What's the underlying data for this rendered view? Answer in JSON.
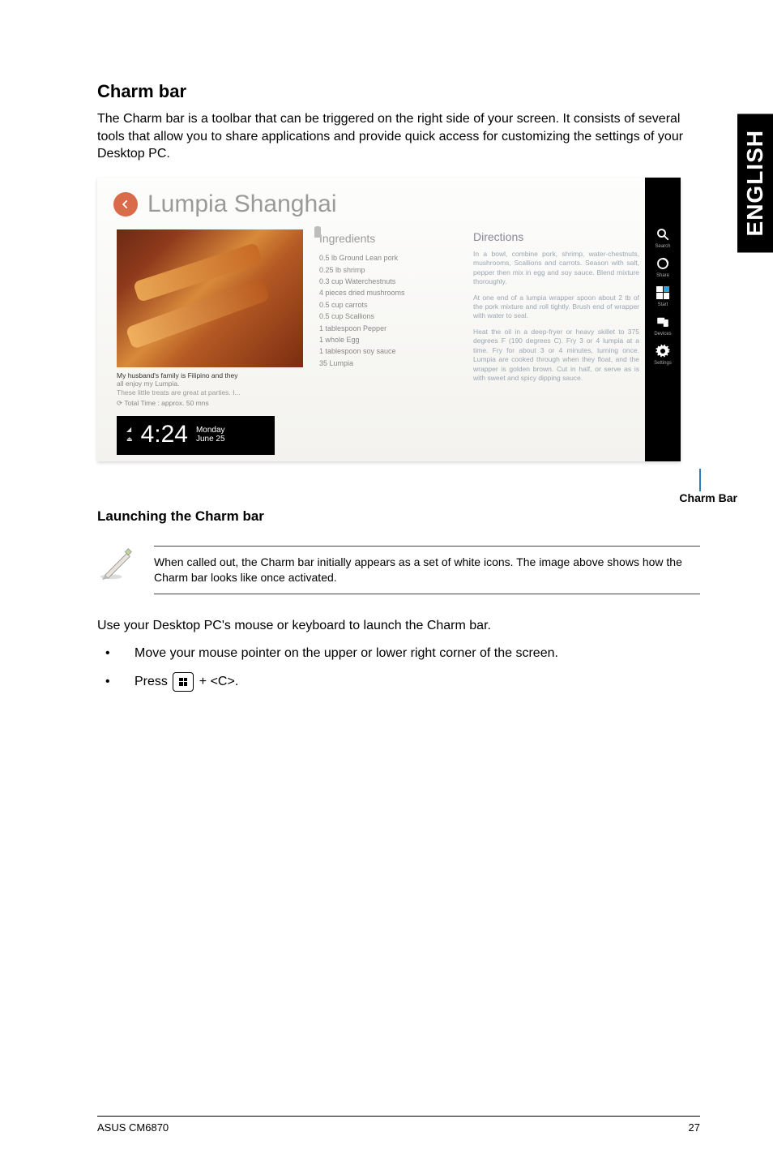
{
  "sideTab": "ENGLISH",
  "heading": "Charm bar",
  "para1": "The Charm bar is a toolbar that can be triggered on the right side of your screen. It consists of several tools that allow you to share applications and provide quick access for customizing the settings of your Desktop PC.",
  "screenshot": {
    "title": "Lumpia Shanghai",
    "caption1": "My husband's family is Filipino and they",
    "caption2": "all enjoy my Lumpia.",
    "caption3": "These little treats are great at parties. I...",
    "totalTime": "⟳ Total Time : approx. 50 mns",
    "clockTime": "4:24",
    "clockDay": "Monday",
    "clockDate": "June 25",
    "ingHeading": "Ingredients",
    "ingredients": [
      "0.5 lb Ground Lean pork",
      "0.25 lb shrimp",
      "0.3 cup Waterchestnuts",
      "4 pieces dried mushrooms",
      "0.5 cup carrots",
      "0.5 cup Scallions",
      "1 tablespoon Pepper",
      "1 whole Egg",
      "1 tablespoon soy sauce",
      "35 Lumpia"
    ],
    "dirHeading": "Directions",
    "dir1": "In a bowl, combine pork, shrimp, water-chestnuts, mushrooms, Scallions and carrots. Season with salt, pepper then mix in egg and soy sauce. Blend mixture thoroughly.",
    "dir2": "At one end of a lumpia wrapper spoon about 2 tb of the pork mixture and roll tightly. Brush end of wrapper with water to seal.",
    "dir3": "Heat the oil in a deep-fryer or heavy skillet to 375 degrees F (190 degrees C). Fry 3 or 4 lumpia at a time. Fry for about 3 or 4 minutes, turning once. Lumpia are cooked through when they float, and the wrapper is golden brown. Cut in half, or serve as is with sweet and spicy dipping sauce.",
    "charms": {
      "search": "Search",
      "share": "Share",
      "start": "Start",
      "devices": "Devices",
      "settings": "Settings"
    }
  },
  "calloutLabel": "Charm Bar",
  "subheading": "Launching the Charm bar",
  "noteText": "When called out, the Charm bar initially appears as a set of white icons. The image above shows how the Charm bar looks like once activated.",
  "instr": "Use your Desktop PC's mouse or keyboard to launch the Charm bar.",
  "bullet1": "Move your mouse pointer on the upper or lower right corner of the screen.",
  "bullet2a": "Press ",
  "bullet2b": " + <C>.",
  "footerLeft": "ASUS CM6870",
  "footerRight": "27"
}
